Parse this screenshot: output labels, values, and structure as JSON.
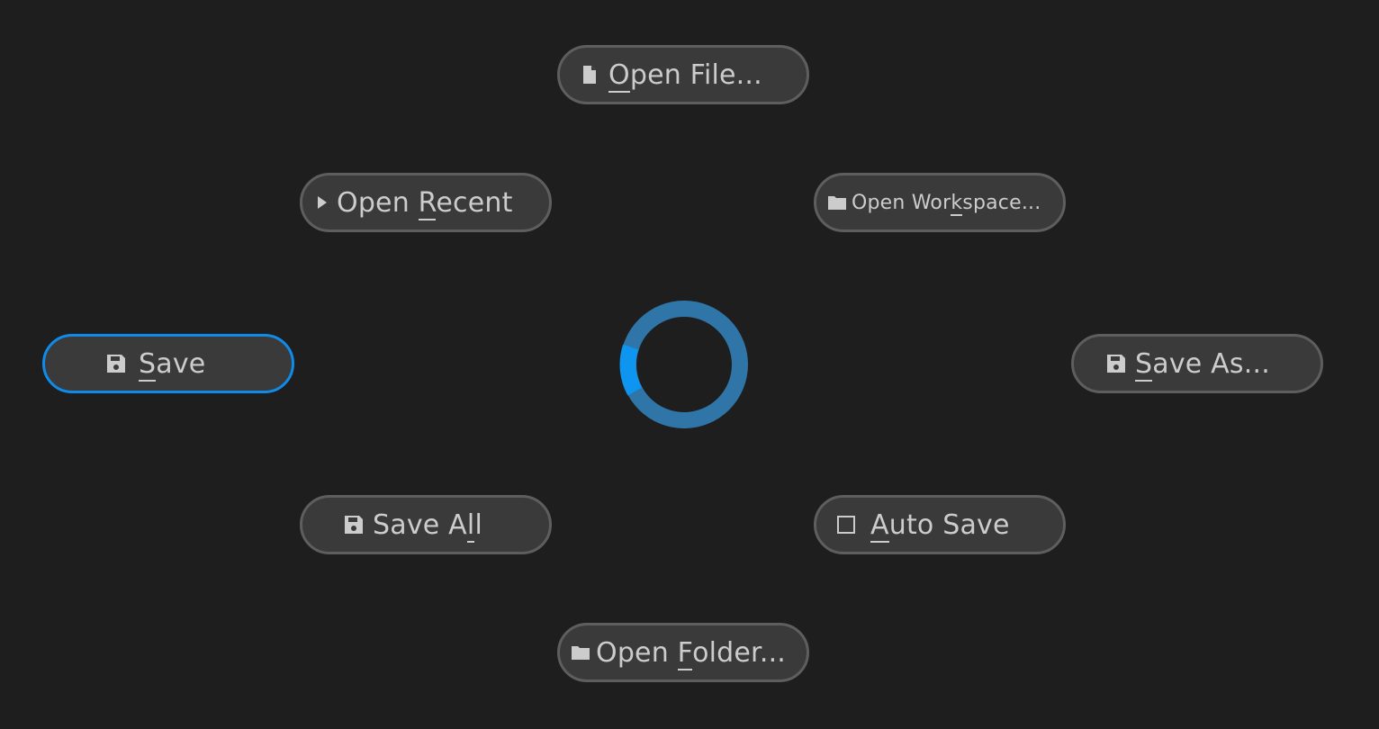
{
  "menu": {
    "open_file": {
      "pre": "",
      "key": "O",
      "post": "pen File...",
      "icon": "file-icon"
    },
    "open_recent": {
      "pre": "Open ",
      "key": "R",
      "post": "ecent",
      "icon": "triangle-right-icon"
    },
    "open_workspace": {
      "pre": "Open Wor",
      "key": "k",
      "post": "space...",
      "icon": "folder-icon"
    },
    "save": {
      "pre": "",
      "key": "S",
      "post": "ave",
      "icon": "floppy-disk-icon"
    },
    "save_as": {
      "pre": "",
      "key": "S",
      "post": "ave As...",
      "icon": "floppy-disk-icon"
    },
    "save_all": {
      "pre": "Save A",
      "key": "l",
      "post": "l",
      "icon": "floppy-disk-icon"
    },
    "auto_save": {
      "pre": "",
      "key": "A",
      "post": "uto Save",
      "icon": "checkbox-icon",
      "checked": false
    },
    "open_folder": {
      "pre": "Open ",
      "key": "F",
      "post": "older...",
      "icon": "folder-icon"
    }
  },
  "colors": {
    "background": "#1e1e1e",
    "pill": "#3a3a3a",
    "pill_border": "#5e5e5e",
    "focus": "#0f8bea",
    "spinner_track": "#2f75a8",
    "spinner_accent": "#0d95f0"
  }
}
